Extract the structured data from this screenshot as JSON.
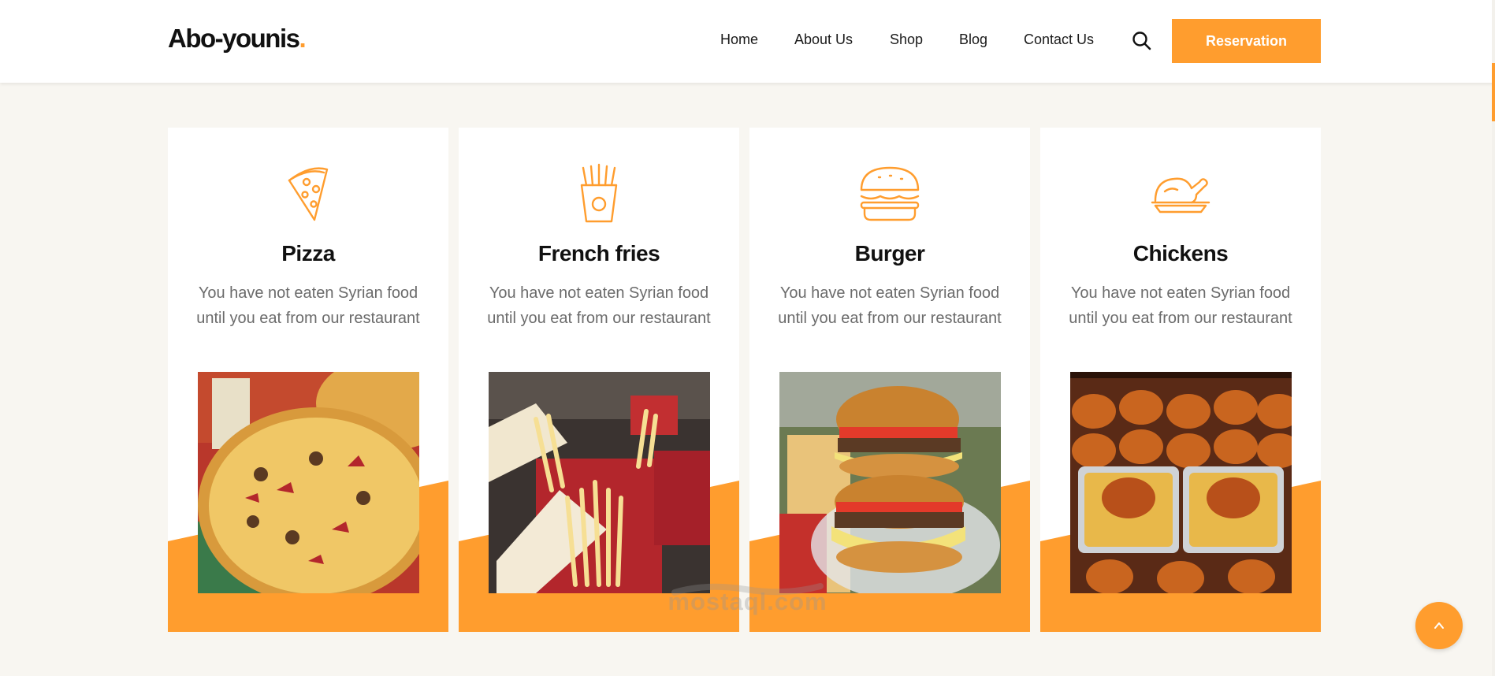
{
  "brand": {
    "name": "Abo-younis",
    "dot": ".",
    "accent": "#ff9d2e"
  },
  "nav": {
    "items": [
      "Home",
      "About Us",
      "Shop",
      "Blog",
      "Contact Us"
    ],
    "search_icon": "search-icon",
    "reservation_label": "Reservation"
  },
  "cards": [
    {
      "title": "Pizza",
      "desc": "You have not eaten Syrian food until you eat from our restaurant",
      "icon": "pizza-icon"
    },
    {
      "title": "French fries",
      "desc": "You have not eaten Syrian food until you eat from our restaurant",
      "icon": "fries-icon"
    },
    {
      "title": "Burger",
      "desc": "You have not eaten Syrian food until you eat from our restaurant",
      "icon": "burger-icon"
    },
    {
      "title": "Chickens",
      "desc": "You have not eaten Syrian food until you eat from our restaurant",
      "icon": "chicken-icon"
    }
  ],
  "watermark": {
    "latin": "mostaql.com"
  },
  "scroll_top_icon": "chevron-up-icon",
  "colors": {
    "accent": "#ff9d2e",
    "page_bg": "#f8f6f1",
    "card_bg": "#ffffff"
  }
}
